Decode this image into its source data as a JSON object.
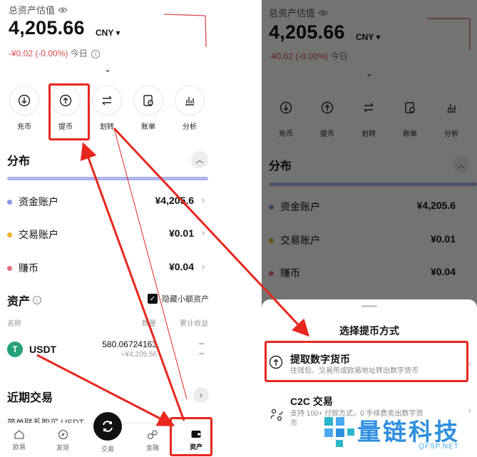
{
  "total_label": "总资产估值",
  "total_value": "4,205.66",
  "currency": "CNY",
  "change_amount": "-¥0.02",
  "change_pct": "(-0.00%)",
  "change_period": "今日",
  "actions": [
    "充币",
    "提币",
    "划转",
    "账单",
    "分析"
  ],
  "distribution": {
    "title": "分布",
    "accounts": [
      {
        "name": "资金账户",
        "value": "¥4,205.6",
        "color": "#8d95e6"
      },
      {
        "name": "交易账户",
        "value": "¥0.01",
        "color": "#f0b429"
      },
      {
        "name": "赚币",
        "value": "¥0.04",
        "color": "#e86b84"
      }
    ]
  },
  "assets": {
    "title": "资产",
    "hide_small": "隐藏小额资产",
    "col_name": "名称",
    "col_amount": "数量",
    "col_pnl": "累计收益",
    "coins": [
      {
        "symbol": "USDT",
        "icon": "tether-icon",
        "amount": "580.06724163",
        "cny": "≈¥4,205.56",
        "pnl_top": "--",
        "pnl_bottom": "--"
      }
    ]
  },
  "recent": {
    "title": "近期交易",
    "cut_text": "简单联系购买 USDT"
  },
  "tabs": [
    "欧易",
    "发现",
    "交易",
    "金融",
    "资产"
  ],
  "withdraw_sheet": {
    "title": "选择提币方式",
    "options": [
      {
        "title": "提取数字货币",
        "desc": "往钱包、交易所或欧易地址转出数字货币",
        "icon": "upload-circle-icon"
      },
      {
        "title": "C2C 交易",
        "desc": "支持 100+ 付款方式，0 手续费卖出数字货",
        "desc2": "币",
        "icon": "c2c-exchange-icon"
      }
    ]
  },
  "watermark": {
    "text": "量链科技",
    "sub": "QFSP.NET"
  },
  "colors": {
    "highlight": "#e8271f",
    "negative": "#d94a55",
    "bar": "#aeb3ee",
    "usdt": "#26a17b"
  }
}
